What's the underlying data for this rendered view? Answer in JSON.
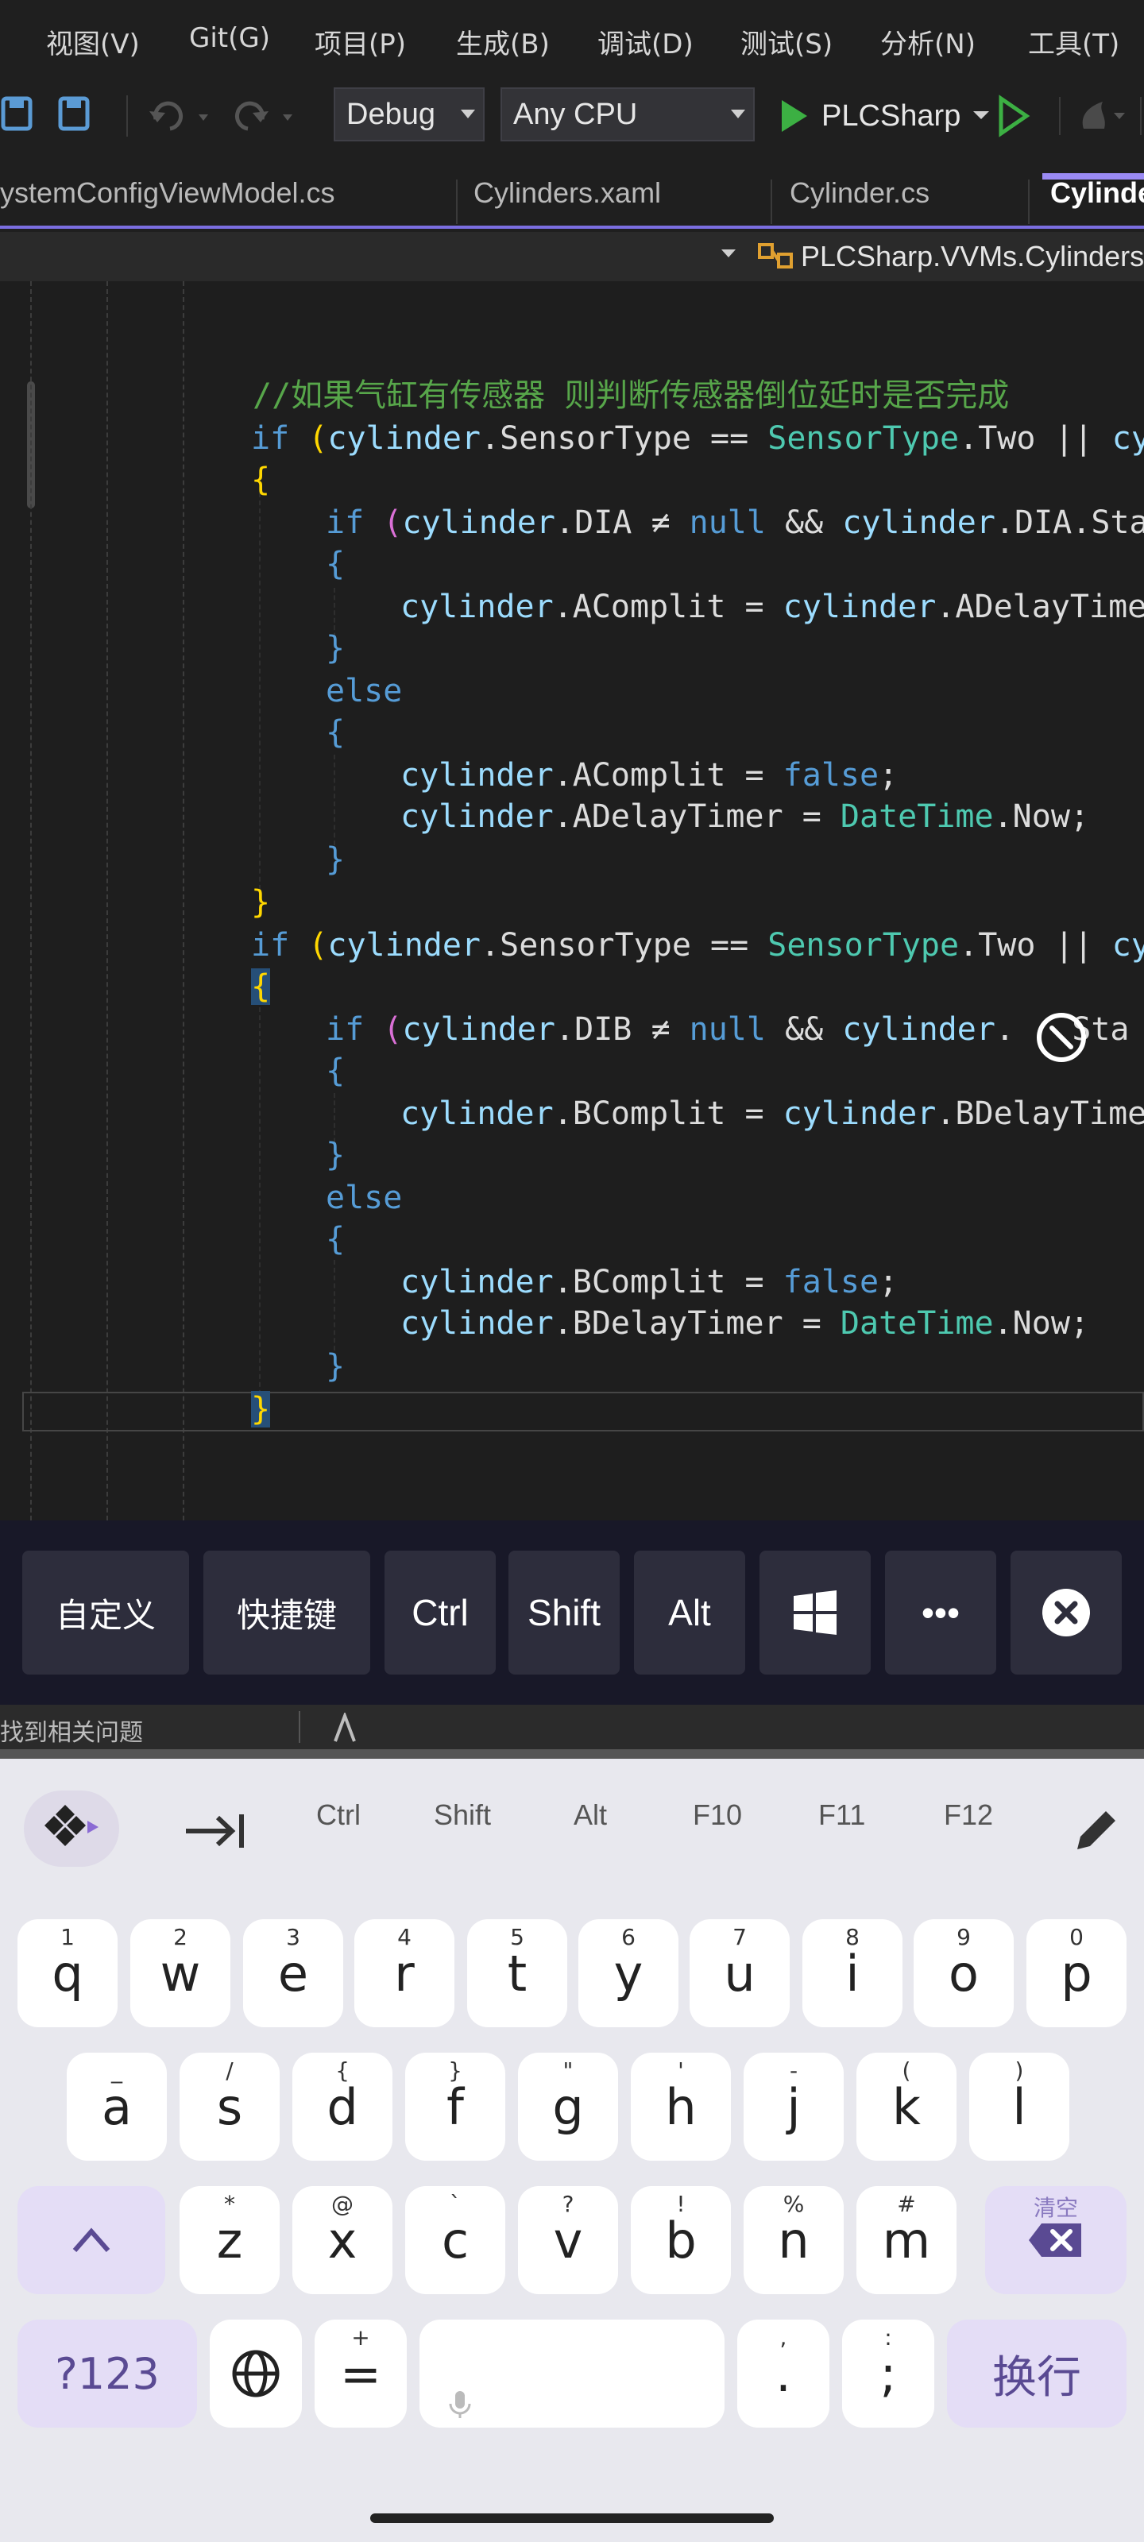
{
  "menubar": {
    "items": [
      "视图(V)",
      "Git(G)",
      "项目(P)",
      "生成(B)",
      "调试(D)",
      "测试(S)",
      "分析(N)",
      "工具(T)"
    ]
  },
  "toolbar": {
    "config": "Debug",
    "platform": "Any CPU",
    "run_target": "PLCSharp"
  },
  "tabs": [
    {
      "label": "ystemConfigViewModel.cs",
      "active": false
    },
    {
      "label": "Cylinders.xaml",
      "active": false
    },
    {
      "label": "Cylinder.cs",
      "active": false
    },
    {
      "label": "Cylinde",
      "active": true
    }
  ],
  "navbar": {
    "member": "PLCSharp.VVMs.Cylinders"
  },
  "code": {
    "comment": "//如果气缸有传感器 则判断传感器倒位延时是否完成",
    "lines": {
      "if_a_kw": "if",
      "cylinder": "cylinder",
      "sensor_type": "SensorType",
      "two": "Two",
      "cy": "cy",
      "dia": "DIA",
      "dib": "DIB",
      "null_kw": "null",
      "sta": "Sta",
      "a_complit": "AComplit",
      "b_complit": "BComplit",
      "a_delay_timer": "ADelayTimer",
      "b_delay_timer": "BDelayTimer",
      "else_kw": "else",
      "false_kw": "false",
      "datetime": "DateTime",
      "now": "Now"
    }
  },
  "shortcut_bar": {
    "custom": "自定义",
    "hotkeys": "快捷键",
    "ctrl": "Ctrl",
    "shift": "Shift",
    "alt": "Alt",
    "more": "•••"
  },
  "status_strip": {
    "text": "找到相关问题"
  },
  "keyboard": {
    "suggestions": [
      "Ctrl",
      "Shift",
      "Alt",
      "F10",
      "F11",
      "F12"
    ],
    "row1": [
      {
        "k": "q",
        "h": "1"
      },
      {
        "k": "w",
        "h": "2"
      },
      {
        "k": "e",
        "h": "3"
      },
      {
        "k": "r",
        "h": "4"
      },
      {
        "k": "t",
        "h": "5"
      },
      {
        "k": "y",
        "h": "6"
      },
      {
        "k": "u",
        "h": "7"
      },
      {
        "k": "i",
        "h": "8"
      },
      {
        "k": "o",
        "h": "9"
      },
      {
        "k": "p",
        "h": "0"
      }
    ],
    "row2": [
      {
        "k": "a",
        "h": "_"
      },
      {
        "k": "s",
        "h": "/"
      },
      {
        "k": "d",
        "h": "{"
      },
      {
        "k": "f",
        "h": "}"
      },
      {
        "k": "g",
        "h": "\""
      },
      {
        "k": "h",
        "h": "'"
      },
      {
        "k": "j",
        "h": "-"
      },
      {
        "k": "k",
        "h": "("
      },
      {
        "k": "l",
        "h": ")"
      }
    ],
    "row3": [
      {
        "k": "z",
        "h": "*"
      },
      {
        "k": "x",
        "h": "@"
      },
      {
        "k": "c",
        "h": "`"
      },
      {
        "k": "v",
        "h": "?"
      },
      {
        "k": "b",
        "h": "!"
      },
      {
        "k": "n",
        "h": "%"
      },
      {
        "k": "m",
        "h": "#"
      }
    ],
    "clear_hint": "清空",
    "num_key": "?123",
    "equals_key": "=",
    "equals_hint": "+",
    "period_key": ".",
    "period_hint": ",",
    "semicolon_key": ";",
    "semicolon_hint": ":",
    "enter_key": "换行"
  }
}
